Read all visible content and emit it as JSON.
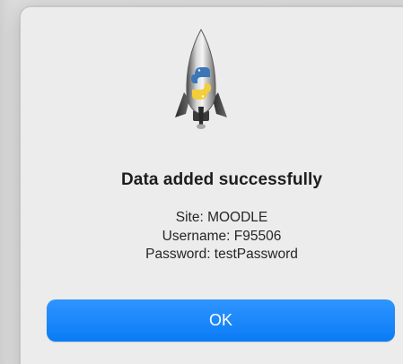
{
  "dialog": {
    "title": "Data added successfully",
    "message_lines": [
      "Site: MOODLE",
      "Username: F95506",
      "Password: testPassword"
    ],
    "ok_label": "OK",
    "app_icon": "python-launcher-rocket-icon"
  },
  "colors": {
    "accent": "#0a7bf5",
    "dialog_background": "#ececec"
  }
}
